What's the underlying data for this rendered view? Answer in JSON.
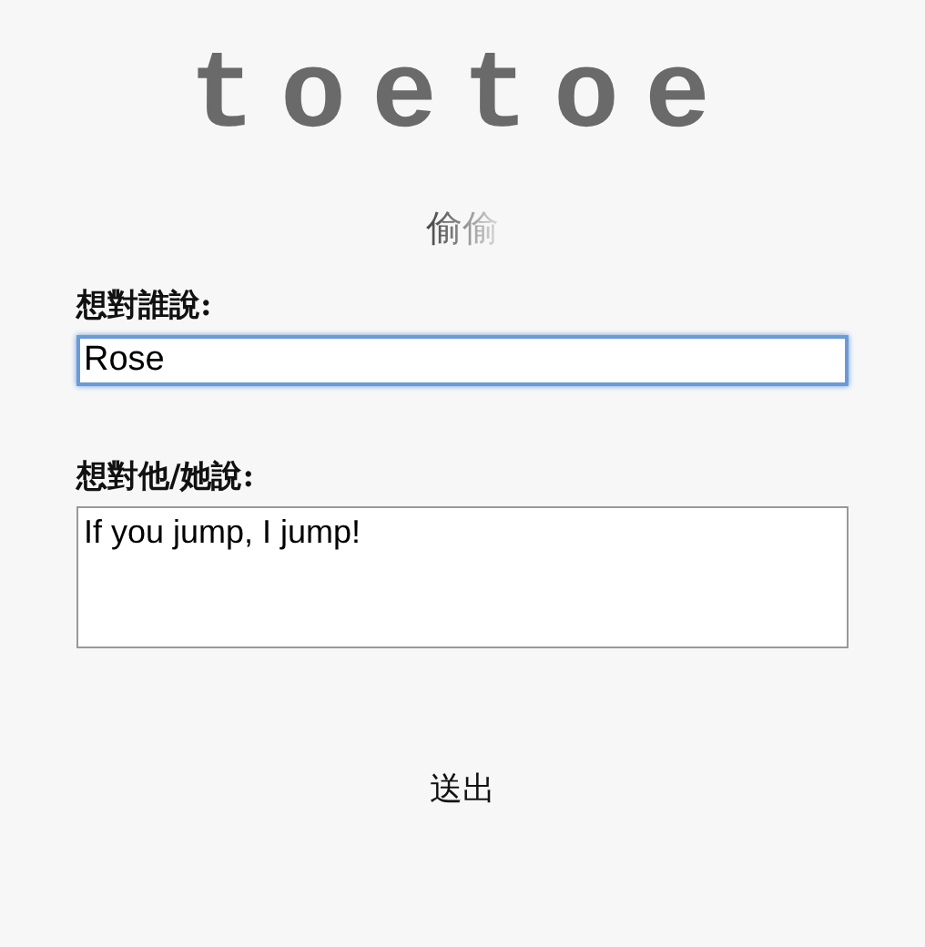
{
  "logo": "toetoe",
  "subtitle": "偷偷",
  "fields": [
    {
      "kind": "input",
      "label": "想對誰說:",
      "value": "Rose",
      "focused": true
    },
    {
      "kind": "textarea",
      "label": "想對他/她說:",
      "value": "If you jump, I jump!",
      "focused": false
    }
  ],
  "submit": "送出"
}
